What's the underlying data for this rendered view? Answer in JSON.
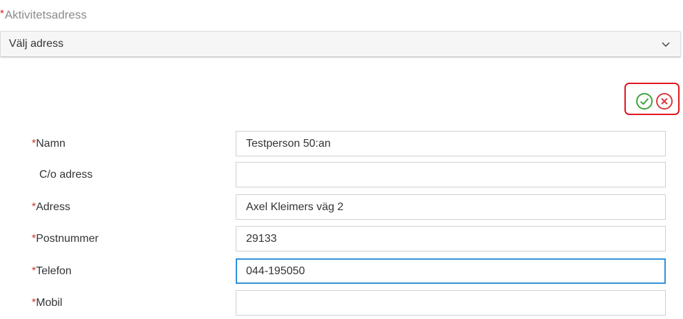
{
  "section": {
    "required_mark": "*",
    "title": "Aktivitetsadress"
  },
  "address_select": {
    "selected": "Välj adress",
    "icon": "chevron-down-icon"
  },
  "actions": {
    "confirm_icon": "check-circle-icon",
    "cancel_icon": "close-circle-icon",
    "confirm_color": "#3aa33a",
    "cancel_color": "#d9363e",
    "highlight_color": "#e0141e"
  },
  "form": {
    "fields": [
      {
        "required_mark": "*",
        "label": "Namn",
        "value": "Testperson 50:an"
      },
      {
        "required_mark": "",
        "label": "C/o adress",
        "value": ""
      },
      {
        "required_mark": "*",
        "label": "Adress",
        "value": "Axel Kleimers väg 2"
      },
      {
        "required_mark": "*",
        "label": "Postnummer",
        "value": "29133"
      },
      {
        "required_mark": "*",
        "label": "Telefon",
        "value": "044-195050"
      },
      {
        "required_mark": "*",
        "label": "Mobil",
        "value": ""
      }
    ]
  }
}
